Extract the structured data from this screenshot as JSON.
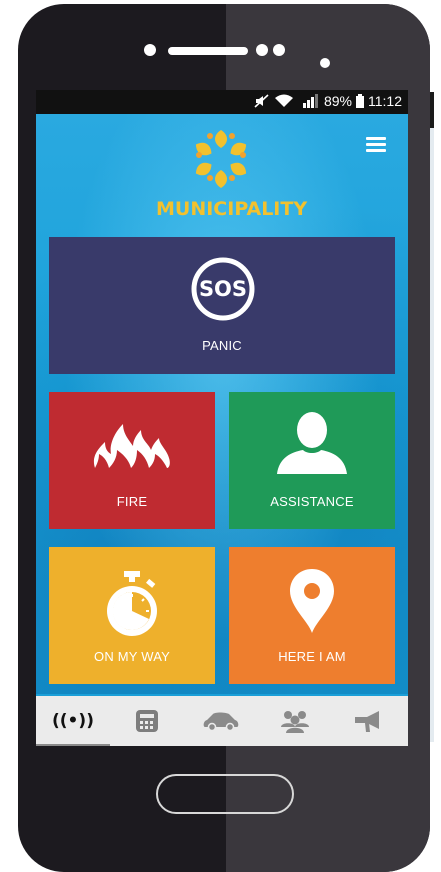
{
  "status_bar": {
    "battery": "89%",
    "time": "11:12"
  },
  "app": {
    "logo_text": "MUNICIPALITY"
  },
  "tiles": {
    "panic": {
      "badge": "SOS",
      "label": "PANIC"
    },
    "fire": {
      "label": "FIRE"
    },
    "assistance": {
      "label": "ASSISTANCE"
    },
    "on_my_way": {
      "label": "ON MY WAY"
    },
    "here_i_am": {
      "label": "HERE I AM"
    }
  },
  "bottom_nav": {
    "items": [
      "broadcast-icon",
      "calculator-icon",
      "car-icon",
      "group-icon",
      "megaphone-icon"
    ],
    "active_index": 0
  },
  "colors": {
    "panic": "#393a6a",
    "fire": "#bf2b31",
    "assistance": "#1f9a58",
    "on_my_way": "#eeb02c",
    "here_i_am": "#ee7e2e",
    "logo": "#f2c12e",
    "background": "#1a9fd8"
  }
}
